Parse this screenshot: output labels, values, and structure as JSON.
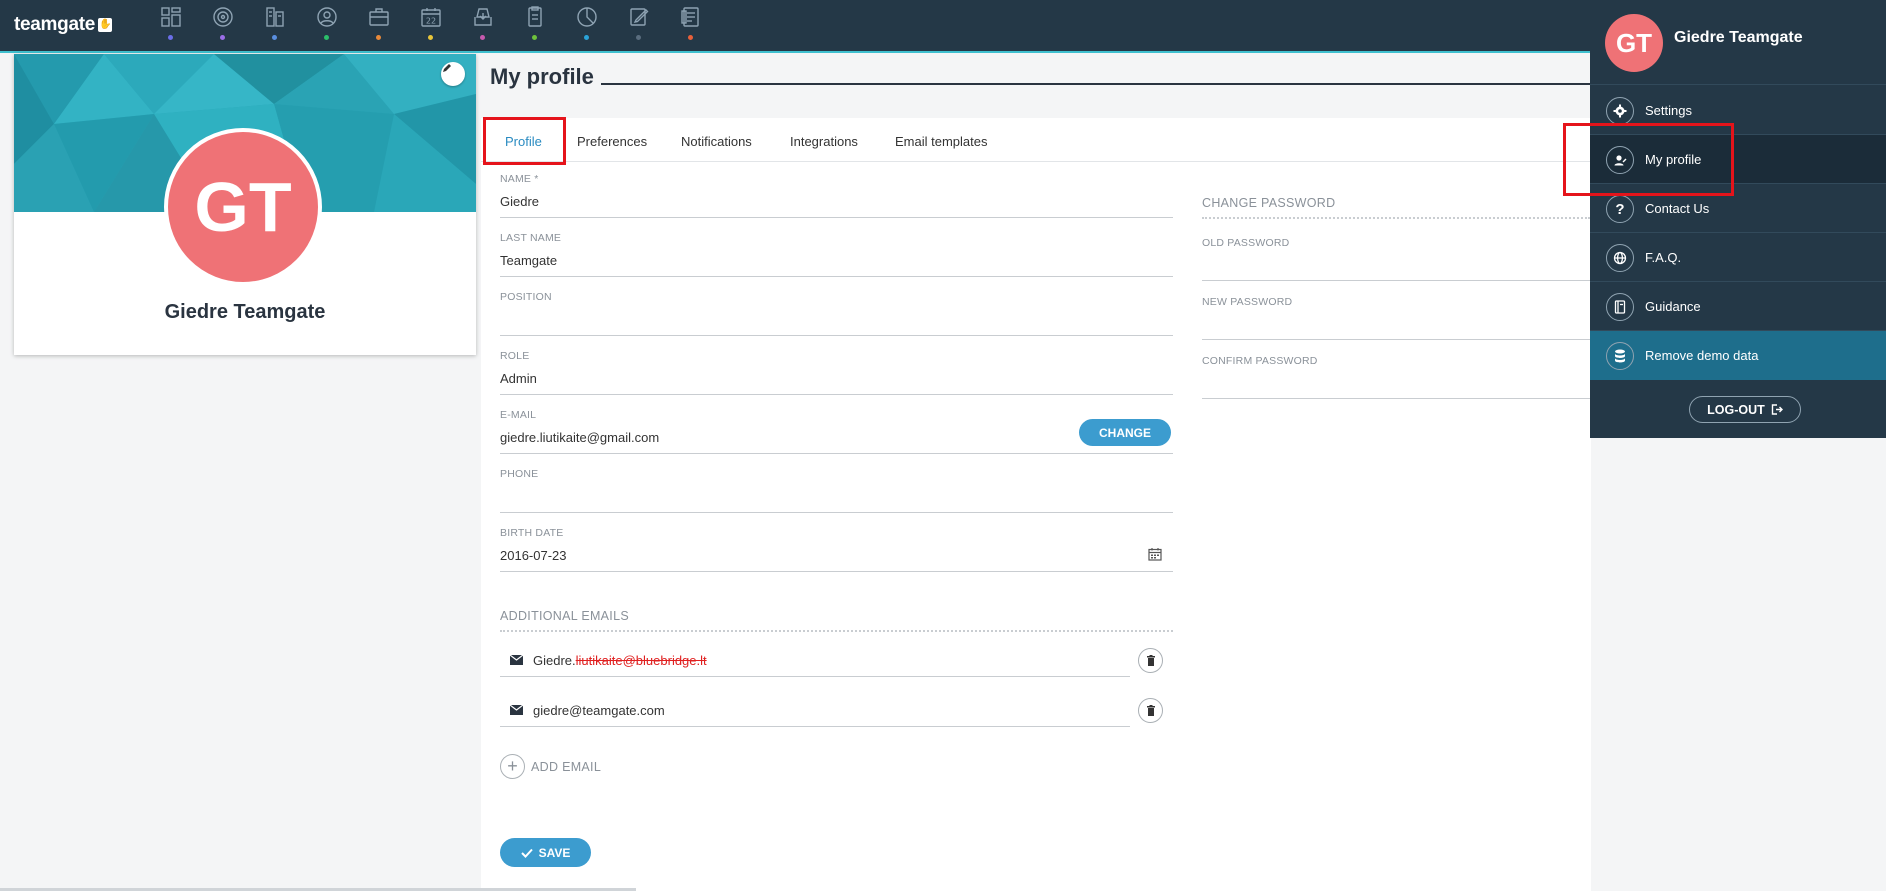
{
  "app": {
    "logo_text": "teamgate",
    "logo_mark": "✋"
  },
  "nav": {
    "items": [
      {
        "icon": "dashboard-icon",
        "dot": "#6b6ee8"
      },
      {
        "icon": "target-icon",
        "dot": "#9b6ee8"
      },
      {
        "icon": "companies-icon",
        "dot": "#5a8fe0"
      },
      {
        "icon": "contacts-icon",
        "dot": "#2bbf6a"
      },
      {
        "icon": "deals-icon",
        "dot": "#e8893a"
      },
      {
        "icon": "calendar-icon",
        "dot": "#e8c53a"
      },
      {
        "icon": "inbox-icon",
        "dot": "#c65aae"
      },
      {
        "icon": "documents-icon",
        "dot": "#6ec23c"
      },
      {
        "icon": "reports-icon",
        "dot": "#2aa3d8"
      },
      {
        "icon": "notes-icon",
        "dot": "#5a6d7e"
      },
      {
        "icon": "forms-icon",
        "dot": "#e8603a"
      }
    ],
    "calendar_day": "22"
  },
  "card": {
    "initials": "GT",
    "name": "Giedre Teamgate"
  },
  "page": {
    "title": "My profile"
  },
  "tabs": [
    {
      "label": "Profile",
      "active": true
    },
    {
      "label": "Preferences"
    },
    {
      "label": "Notifications"
    },
    {
      "label": "Integrations"
    },
    {
      "label": "Email templates"
    }
  ],
  "form": {
    "name_label": "NAME *",
    "name_value": "Giedre",
    "last_name_label": "LAST NAME",
    "last_name_value": "Teamgate",
    "position_label": "POSITION",
    "position_value": "",
    "role_label": "ROLE",
    "role_value": "Admin",
    "email_label": "E-MAIL",
    "email_value": "giedre.liutikaite@gmail.com",
    "change_label": "CHANGE",
    "phone_label": "PHONE",
    "phone_value": "",
    "birth_label": "BIRTH DATE",
    "birth_value": "2016-07-23",
    "additional_label": "ADDITIONAL EMAILS",
    "additional_emails": [
      {
        "prefix": "Giedre.",
        "struck": "liutikaite@bluebridge.lt"
      },
      {
        "prefix": "giedre@teamgate.com",
        "struck": ""
      }
    ],
    "add_email_label": "ADD EMAIL",
    "save_label": "SAVE"
  },
  "password": {
    "section_label": "CHANGE PASSWORD",
    "old_label": "OLD PASSWORD",
    "new_label": "NEW PASSWORD",
    "confirm_label": "CONFIRM PASSWORD"
  },
  "dropdown": {
    "initials": "GT",
    "name": "Giedre Teamgate",
    "items": [
      {
        "label": "Settings",
        "icon": "gear-icon"
      },
      {
        "label": "My profile",
        "icon": "user-icon"
      },
      {
        "label": "Contact Us",
        "icon": "question-icon"
      },
      {
        "label": "F.A.Q.",
        "icon": "globe-icon"
      },
      {
        "label": "Guidance",
        "icon": "book-icon"
      },
      {
        "label": "Remove demo data",
        "icon": "database-icon"
      }
    ],
    "logout_label": "LOG-OUT"
  },
  "colors": {
    "nav_bg": "#243847",
    "accent": "#3c9ccf",
    "avatar": "#ef7276",
    "highlight": "#e5141b"
  }
}
